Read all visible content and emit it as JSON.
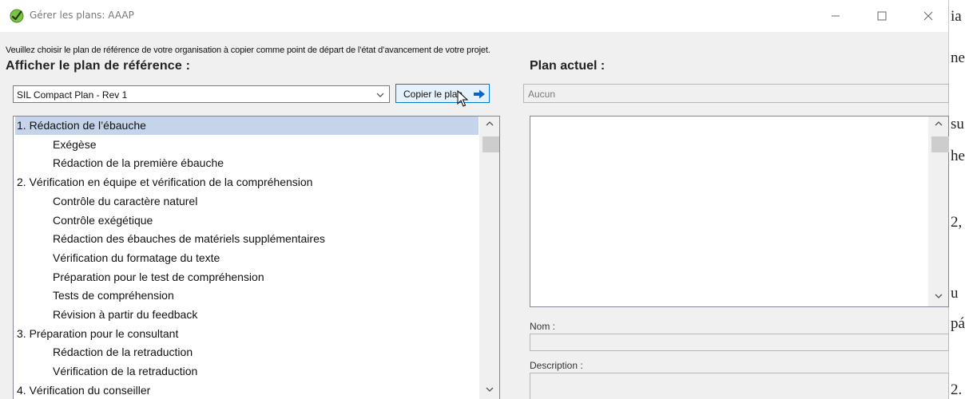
{
  "window": {
    "title": "Gérer les plans: AAAP"
  },
  "instructions": "Veuillez choisir le plan de référence de votre organisation à copier comme point de départ de l’état d’avancement de votre projet.",
  "left_heading": "Afficher le plan de référence :",
  "right_heading": "Plan actuel :",
  "reference_plan_select": {
    "selected": "SIL Compact Plan - Rev 1"
  },
  "copy_button": {
    "label": "Copier le plan"
  },
  "current_plan_field": {
    "value": "Aucun"
  },
  "reference_tree": [
    {
      "text": "1. Rédaction de l’ébauche",
      "level": 0,
      "selected": true
    },
    {
      "text": "Exégèse",
      "level": 1
    },
    {
      "text": "Rédaction de la première ébauche",
      "level": 1
    },
    {
      "text": "2. Vérification en équipe et vérification de la compréhension",
      "level": 0
    },
    {
      "text": "Contrôle du caractère naturel",
      "level": 1
    },
    {
      "text": "Contrôle exégétique",
      "level": 1
    },
    {
      "text": "Rédaction des ébauches de matériels supplémentaires",
      "level": 1
    },
    {
      "text": "Vérification du formatage du texte",
      "level": 1
    },
    {
      "text": "Préparation pour le test de compréhension",
      "level": 1
    },
    {
      "text": "Tests de compréhension",
      "level": 1
    },
    {
      "text": "Révision à partir du feedback",
      "level": 1
    },
    {
      "text": "3. Préparation pour le consultant",
      "level": 0
    },
    {
      "text": "Rédaction de la retraduction",
      "level": 1
    },
    {
      "text": "Vérification de la retraduction",
      "level": 1
    },
    {
      "text": "4. Vérification du conseiller",
      "level": 0
    }
  ],
  "stage_fields": {
    "name_label": "Nom :",
    "name_value": "",
    "description_label": "Description :",
    "description_value": ""
  },
  "background_document": {
    "fragments": [
      "ia",
      "ne",
      "su",
      "he",
      "2,",
      "u",
      "pá",
      "2."
    ]
  },
  "colors": {
    "selection": "#c5d4ea",
    "accent_border": "#0078d7",
    "arrow": "#0a64c8",
    "icon_green": "#7cc243"
  },
  "icons": [
    "app-check-icon",
    "minimize-icon",
    "maximize-icon",
    "close-icon",
    "chevron-down-icon",
    "arrow-right-icon",
    "mouse-pointer-icon",
    "scroll-up-arrow-icon",
    "scroll-down-arrow-icon"
  ]
}
